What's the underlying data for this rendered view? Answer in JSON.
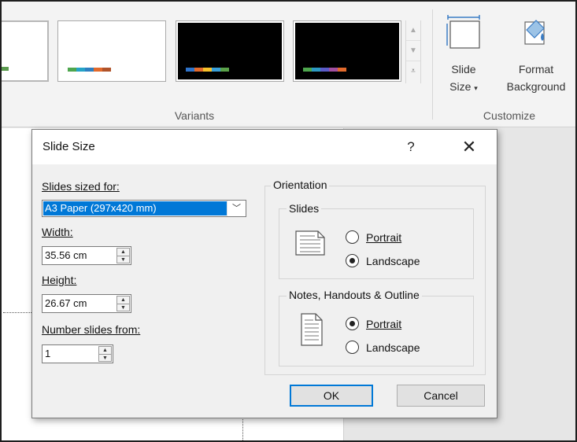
{
  "ribbon": {
    "variants_label": "Variants",
    "customize_label": "Customize",
    "slide_size_label_1": "Slide",
    "slide_size_label_2": "Size",
    "format_bg_label_1": "Format",
    "format_bg_label_2": "Background",
    "variant_colors": {
      "partial": [
        "#5b9b4f"
      ],
      "white": [
        "#4ea64e",
        "#25a3c7",
        "#2e7fc1",
        "#e26a2c",
        "#b0532a"
      ],
      "dark1": [
        "#2f73c9",
        "#e26a2c",
        "#f6c12b",
        "#3aa0d9",
        "#5aa24a"
      ],
      "dark2": [
        "#4ea64e",
        "#2d9ac4",
        "#5b5bc8",
        "#a24fa0",
        "#e26a2c"
      ]
    }
  },
  "dialog": {
    "title": "Slide Size",
    "help": "?",
    "close": "✕",
    "slides_sized_for_label": "Slides sized for:",
    "slides_sized_for_value": "A3 Paper (297x420 mm)",
    "width_label": "Width:",
    "width_value": "35.56 cm",
    "height_label": "Height:",
    "height_value": "26.67 cm",
    "number_from_label": "Number slides from:",
    "number_from_value": "1",
    "orientation_label": "Orientation",
    "slides_group_label": "Slides",
    "notes_group_label": "Notes, Handouts & Outline",
    "portrait_label": "Portrait",
    "landscape_label": "Landscape",
    "slides_selected": "Landscape",
    "notes_selected": "Portrait",
    "ok_label": "OK",
    "cancel_label": "Cancel"
  }
}
